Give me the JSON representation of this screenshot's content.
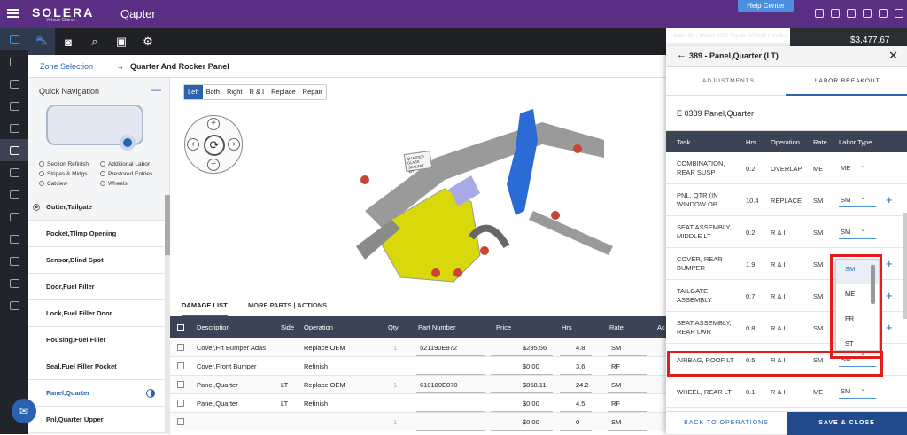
{
  "header": {
    "logo": "SOLERA",
    "logo_sub": "Vehicle Claims",
    "app": "Qapter",
    "help": "Help Center"
  },
  "toolbar": {
    "claim": "Claim ID:   |  Model:   2025 Toyota GRAND HIGHL...",
    "total": "$3,477.67"
  },
  "breadcrumb": {
    "link": "Zone Selection",
    "sep": "→",
    "current": "Quarter And Rocker Panel"
  },
  "quick_nav": {
    "title": "Quick Navigation",
    "legend": [
      "Section Refinish",
      "Additional Labor",
      "Stripes & Midgs",
      "Prestored Entries",
      "Catview",
      "Wheels"
    ]
  },
  "parts": [
    "Gutter,Tailgate",
    "Pocket,Tllmp Opening",
    "Sensor,Blind Spot",
    "Door,Fuel Filler",
    "Lock,Fuel Filler Door",
    "Housing,Fuel Filler",
    "Seal,Fuel Filler Pocket",
    "Panel,Quarter",
    "Pnl,Quarter Upper"
  ],
  "view": {
    "segments": [
      "Left",
      "Both",
      "Right",
      "R & I",
      "Replace",
      "Repair"
    ],
    "diagram_label": "QUARTER GLASS SEALANT KIT"
  },
  "tabs": {
    "damage": "DAMAGE LIST",
    "more": "MORE PARTS | ACTIONS"
  },
  "grid": {
    "headers": [
      "Description",
      "Side",
      "Operation",
      "Qty",
      "Part Number",
      "Price",
      "Hrs",
      "Rate",
      "Ac"
    ],
    "rows": [
      {
        "desc": "Cover,Frt Bumper Adas",
        "side": "",
        "op": "Replace OEM",
        "qty": "1",
        "part": "521190E972",
        "price": "$295.56",
        "hrs": "4.8",
        "rate": "SM"
      },
      {
        "desc": "Cover,Front Bumper",
        "side": "",
        "op": "Refinish",
        "qty": "",
        "part": "",
        "price": "$0.00",
        "hrs": "3.6",
        "rate": "RF"
      },
      {
        "desc": "Panel,Quarter",
        "side": "LT",
        "op": "Replace OEM",
        "qty": "1",
        "part": "610180E070",
        "price": "$858.11",
        "hrs": "24.2",
        "rate": "SM"
      },
      {
        "desc": "Panel,Quarter",
        "side": "LT",
        "op": "Refinish",
        "qty": "",
        "part": "",
        "price": "$0.00",
        "hrs": "4.5",
        "rate": "RF"
      },
      {
        "desc": "",
        "side": "",
        "op": "",
        "qty": "1",
        "part": "",
        "price": "$0.00",
        "hrs": "0",
        "rate": "SM"
      }
    ]
  },
  "panel": {
    "title": "389 - Panel,Quarter (LT)",
    "tab_adj": "ADJUSTMENTS",
    "tab_labor": "LABOR BREAKOUT",
    "code": "E 0389 Panel,Quarter",
    "headers": [
      "Task",
      "Hrs",
      "Operation",
      "Rate",
      "Labor Type"
    ],
    "rows": [
      {
        "task": "COMBINATION, REAR SUSP",
        "hrs": "0.2",
        "op": "OVERLAP",
        "rate": "ME",
        "type": "ME"
      },
      {
        "task": "PNL, QTR (IN WINDOW OP...",
        "hrs": "10.4",
        "op": "REPLACE",
        "rate": "SM",
        "type": "SM"
      },
      {
        "task": "SEAT ASSEMBLY, MIDDLE LT",
        "hrs": "0.2",
        "op": "R & I",
        "rate": "SM",
        "type": "SM"
      },
      {
        "task": "COVER, REAR BUMPER",
        "hrs": "1.9",
        "op": "R & I",
        "rate": "SM",
        "type": ""
      },
      {
        "task": "TAILGATE ASSEMBLY",
        "hrs": "0.7",
        "op": "R & I",
        "rate": "SM",
        "type": ""
      },
      {
        "task": "SEAT ASSEMBLY, REAR LWR",
        "hrs": "0.8",
        "op": "R & I",
        "rate": "SM",
        "type": ""
      },
      {
        "task": "AIRBAG, ROOF LT",
        "hrs": "0.5",
        "op": "R & I",
        "rate": "SM",
        "type": "SM"
      },
      {
        "task": "WHEEL, REAR LT",
        "hrs": "0.1",
        "op": "R & I",
        "rate": "ME",
        "type": "SM"
      }
    ],
    "dropdown": [
      "SM",
      "ME",
      "FR",
      "ST"
    ],
    "back": "BACK TO OPERATIONS",
    "save": "SAVE & CLOSE"
  }
}
